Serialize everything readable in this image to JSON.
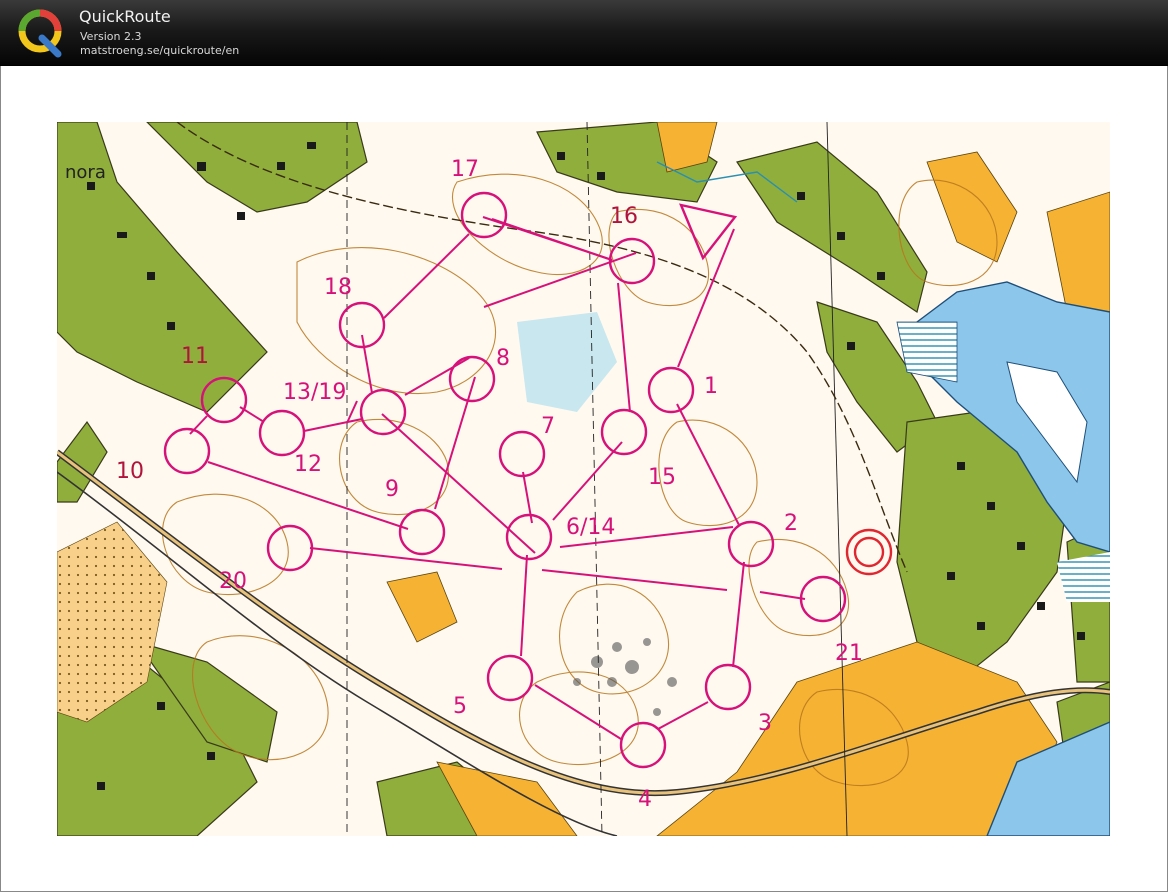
{
  "app": {
    "title": "QuickRoute",
    "version": "Version 2.3",
    "url": "matstroeng.se/quickroute/en"
  },
  "map": {
    "place_label": "nora",
    "course_color": "#d6127a",
    "controls": [
      {
        "label": "1"
      },
      {
        "label": "2"
      },
      {
        "label": "3"
      },
      {
        "label": "4"
      },
      {
        "label": "5"
      },
      {
        "label": "6/14"
      },
      {
        "label": "7"
      },
      {
        "label": "8"
      },
      {
        "label": "9"
      },
      {
        "label": "10"
      },
      {
        "label": "11"
      },
      {
        "label": "12"
      },
      {
        "label": "13/19"
      },
      {
        "label": "15"
      },
      {
        "label": "16"
      },
      {
        "label": "17"
      },
      {
        "label": "18"
      },
      {
        "label": "20"
      },
      {
        "label": "21"
      }
    ]
  }
}
